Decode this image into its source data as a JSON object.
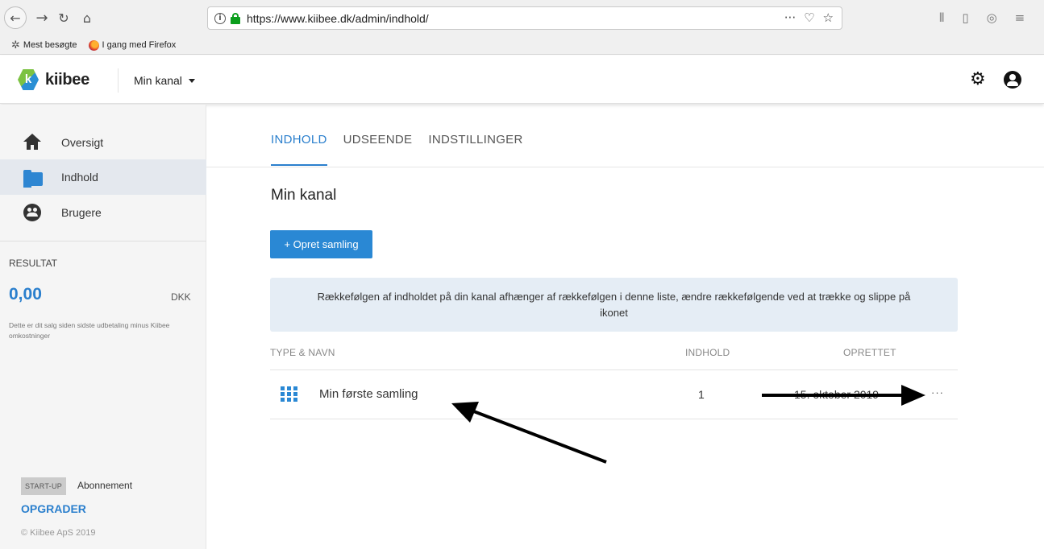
{
  "browser": {
    "url": "https://www.kiibee.dk/admin/indhold/",
    "bookmarks": [
      "Mest besøgte",
      "I gang med Firefox"
    ],
    "page_actions_label": "···"
  },
  "header": {
    "logo_text": "kiibee",
    "channel_select": "Min kanal",
    "icons": [
      "gear-icon",
      "user-icon"
    ]
  },
  "sidebar": {
    "items": [
      {
        "label": "Oversigt",
        "icon": "home-icon"
      },
      {
        "label": "Indhold",
        "icon": "folder-icon",
        "active": true
      },
      {
        "label": "Brugere",
        "icon": "users-icon"
      }
    ],
    "result_label": "RESULTAT",
    "result_amount": "0,00",
    "result_currency": "DKK",
    "result_note": "Dette er dit salg siden sidste udbetaling minus Kiibee omkostninger",
    "plan_badge": "START-UP",
    "plan_label": "Abonnement",
    "upgrade_link": "OPGRADER",
    "copyright": "© Kiibee ApS 2019"
  },
  "main": {
    "tabs": [
      {
        "label": "INDHOLD",
        "active": true
      },
      {
        "label": "UDSEENDE"
      },
      {
        "label": "INDSTILLINGER"
      }
    ],
    "page_title": "Min kanal",
    "create_button": "+ Opret samling",
    "info_text": "Rækkefølgen af indholdet på din kanal afhænger af rækkefølgen i denne liste, ændre rækkefølgende ved at trække og slippe på ikonet",
    "table": {
      "columns": [
        "TYPE & NAVN",
        "INDHOLD",
        "OPRETTET"
      ],
      "rows": [
        {
          "name": "Min første samling",
          "count": "1",
          "created": "15. oktober 2019",
          "more": "···"
        }
      ]
    }
  },
  "colors": {
    "accent": "#2a88d4",
    "sidebar_bg": "#f5f5f5",
    "active_item_bg": "#e4e8ee",
    "info_bg": "#e5edf5"
  }
}
